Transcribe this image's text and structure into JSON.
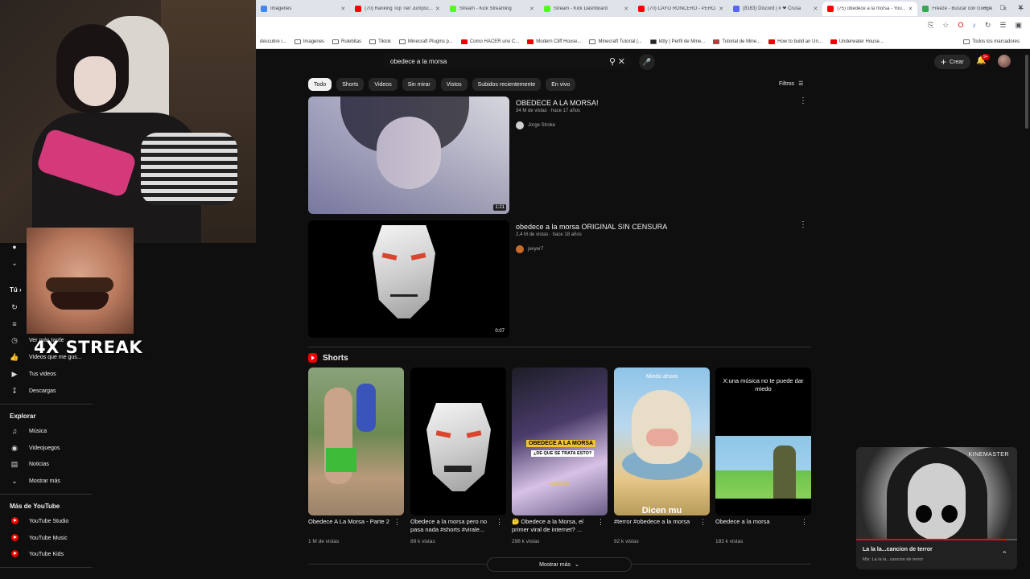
{
  "browser": {
    "tabs": [
      {
        "title": "Imágenes",
        "color": "#4285f4"
      },
      {
        "title": "(70) Ranking Top Tier Jumpsc...",
        "color": "#ff0000"
      },
      {
        "title": "Stream - Kick Streaming",
        "color": "#53fc18"
      },
      {
        "title": "Stream - Kick Dashboard",
        "color": "#53fc18"
      },
      {
        "title": "(70) CAYÓ RONCERO - PERO...",
        "color": "#ff0000"
      },
      {
        "title": "(8163) Discord | # ❤ Crusa",
        "color": "#5865f2"
      },
      {
        "title": "(75) obedece a la morsa - You...",
        "color": "#ff0000",
        "active": true
      },
      {
        "title": "Freeze - Buscar con Google",
        "color": "#34a853"
      }
    ],
    "window_controls": [
      "–",
      "□",
      "✕"
    ],
    "toolbar_icons": [
      "⎘",
      "☆",
      "O",
      "♪",
      "↻",
      "☰",
      "▣"
    ],
    "bookmarks": [
      {
        "label": "descubre i...",
        "type": "plain"
      },
      {
        "label": "Imagenes",
        "type": "folder"
      },
      {
        "label": "Rulebitas",
        "type": "folder"
      },
      {
        "label": "Tiktok",
        "type": "folder"
      },
      {
        "label": "Minecraft Plugins p...",
        "type": "folder"
      },
      {
        "label": "Como HACER uno C...",
        "type": "yt"
      },
      {
        "label": "Modern Cliff House...",
        "type": "yt"
      },
      {
        "label": "Minecraft Tutorial |...",
        "type": "folder"
      },
      {
        "label": "kttty | Perfil de Mine...",
        "type": "plain"
      },
      {
        "label": "Tutorial de Mine...",
        "type": "plain"
      },
      {
        "label": "How to build an Un...",
        "type": "yt"
      },
      {
        "label": "Underwater House...",
        "type": "yt"
      }
    ],
    "bookmarks_all": "Todos los marcadores"
  },
  "overlay": {
    "streak_text": "4X STREAK"
  },
  "youtube": {
    "search_query": "obedece a la morsa",
    "create_label": "Crear",
    "notifications_badge": "9+",
    "chips": [
      "Todo",
      "Shorts",
      "Videos",
      "Sin mirar",
      "Vistos",
      "Subidos recientemente",
      "En vivo"
    ],
    "filters_label": "Filtros",
    "videos": [
      {
        "title": "OBEDECE A LA MORSA!",
        "meta": "34 M de vistas · hace 17 años",
        "channel": "Jorge Stroke",
        "duration": "1:21"
      },
      {
        "title": "obedece a la morsa ORIGINAL SIN CENSURA",
        "meta": "2,4 M de vistas · hace 18 años",
        "channel": "javyer7",
        "duration": "0:07"
      }
    ],
    "shorts_heading": "Shorts",
    "shorts": [
      {
        "title": "Obedece A La Morsa - Parte 2",
        "views": "1 M de vistas"
      },
      {
        "title": "Obedece a la morsa pero no pasa nada #shorts #virale...",
        "views": "89 k vistas"
      },
      {
        "title": "🤔 Obedece a la Morsa, el primer viral de internet? ...",
        "views": "298 k vistas"
      },
      {
        "title": "#terror #obedece a la morsa",
        "views": "92 k vistas"
      },
      {
        "title": "Obedece a la morsa",
        "views": "183 k vistas"
      }
    ],
    "short_captions": {
      "s3_top": "OBEDECE A LA MORSA",
      "s3_sub": "¿DE QUE SE TRATA ESTO?",
      "s3_bottom": "la persona",
      "s4_top": "Miedo ahora",
      "s4_bottom": "Dicen mu",
      "s5_top": "X:una música no te puede dar miedo"
    },
    "show_more": "Mostrar más"
  },
  "sidebar": {
    "you_heading": "Tú",
    "you_items": [
      {
        "label": "Ver más tarde",
        "icon": "clock-icon"
      },
      {
        "label": "Videos que me gus...",
        "icon": "thumb-up-icon"
      },
      {
        "label": "Tus videos",
        "icon": "play-box-icon"
      },
      {
        "label": "Descargas",
        "icon": "download-icon"
      }
    ],
    "explore_heading": "Explorar",
    "explore_items": [
      {
        "label": "Música",
        "icon": "music-icon"
      },
      {
        "label": "Videojuegos",
        "icon": "gamepad-icon"
      },
      {
        "label": "Noticias",
        "icon": "news-icon"
      },
      {
        "label": "Mostrar más",
        "icon": "chevron-down-icon"
      }
    ],
    "more_heading": "Más de YouTube",
    "more_items": [
      {
        "label": "YouTube Studio"
      },
      {
        "label": "YouTube Music"
      },
      {
        "label": "YouTube Kids"
      }
    ]
  },
  "miniplayer": {
    "watermark": "KINEMASTER",
    "title": "La la la...cancion de terror",
    "subtitle": "Mix: La la la...cancion de terror",
    "progress": 0.93
  }
}
